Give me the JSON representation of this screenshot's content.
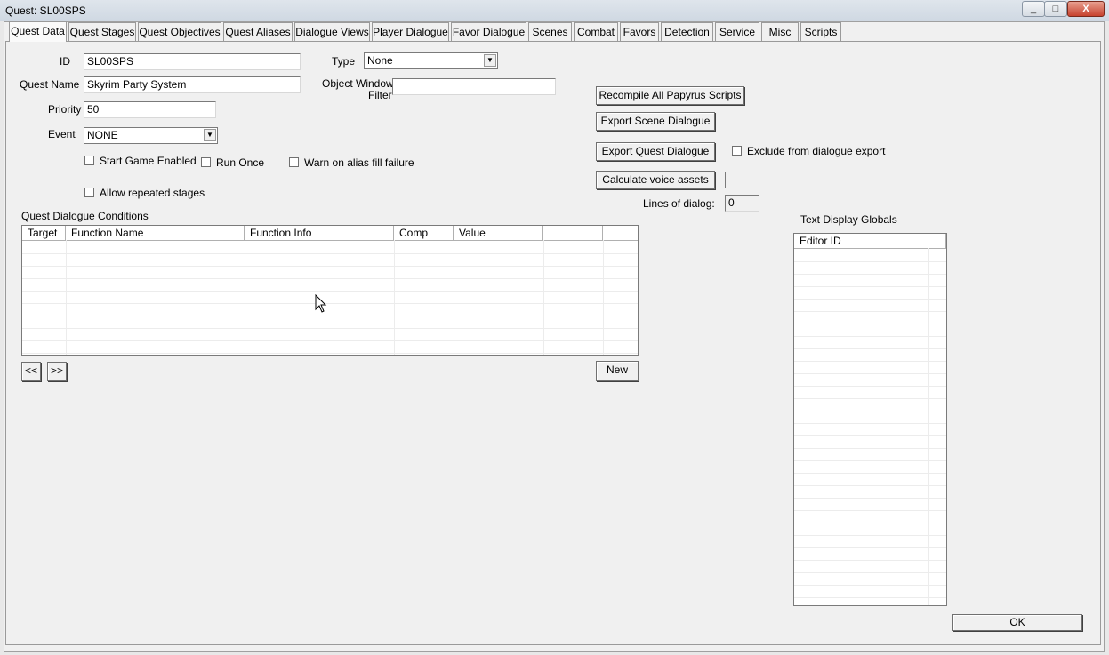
{
  "window": {
    "title": "Quest: SL00SPS",
    "close_glyph": "X",
    "max_glyph": "□",
    "min_glyph": "_"
  },
  "tabs": [
    {
      "label": "Quest Data",
      "active": true
    },
    {
      "label": "Quest Stages"
    },
    {
      "label": "Quest Objectives"
    },
    {
      "label": "Quest Aliases"
    },
    {
      "label": "Dialogue Views"
    },
    {
      "label": "Player Dialogue"
    },
    {
      "label": "Favor Dialogue"
    },
    {
      "label": "Scenes"
    },
    {
      "label": "Combat"
    },
    {
      "label": "Favors"
    },
    {
      "label": "Detection"
    },
    {
      "label": "Service"
    },
    {
      "label": "Misc"
    },
    {
      "label": "Scripts"
    }
  ],
  "form": {
    "id_label": "ID",
    "id_value": "SL00SPS",
    "quest_name_label": "Quest Name",
    "quest_name_value": "Skyrim Party System",
    "priority_label": "Priority",
    "priority_value": "50",
    "event_label": "Event",
    "event_value": "NONE",
    "type_label": "Type",
    "type_value": "None",
    "object_window_filter_label_1": "Object Window",
    "object_window_filter_label_2": "Filter",
    "object_window_filter_value": "",
    "start_game_enabled_label": "Start Game Enabled",
    "start_game_enabled_checked": false,
    "run_once_label": "Run Once",
    "run_once_checked": false,
    "warn_alias_label": "Warn on alias fill failure",
    "warn_alias_checked": false,
    "allow_repeated_label": "Allow repeated stages",
    "allow_repeated_checked": false
  },
  "actions": {
    "recompile": "Recompile All Papyrus Scripts",
    "export_scene": "Export Scene Dialogue",
    "export_quest": "Export Quest Dialogue",
    "exclude_label": "Exclude from dialogue export",
    "exclude_checked": false,
    "calc_voice": "Calculate voice assets",
    "calc_voice_value": "",
    "lines_label": "Lines of dialog:",
    "lines_value": "0"
  },
  "conditions": {
    "title": "Quest Dialogue Conditions",
    "columns": [
      "Target",
      "Function Name",
      "Function Info",
      "Comp",
      "Value",
      ""
    ],
    "rows": [],
    "prev_label": "<<",
    "next_label": ">>",
    "new_label": "New"
  },
  "globals": {
    "title": "Text Display Globals",
    "columns": [
      "Editor ID",
      ""
    ],
    "rows": []
  },
  "ok_label": "OK"
}
